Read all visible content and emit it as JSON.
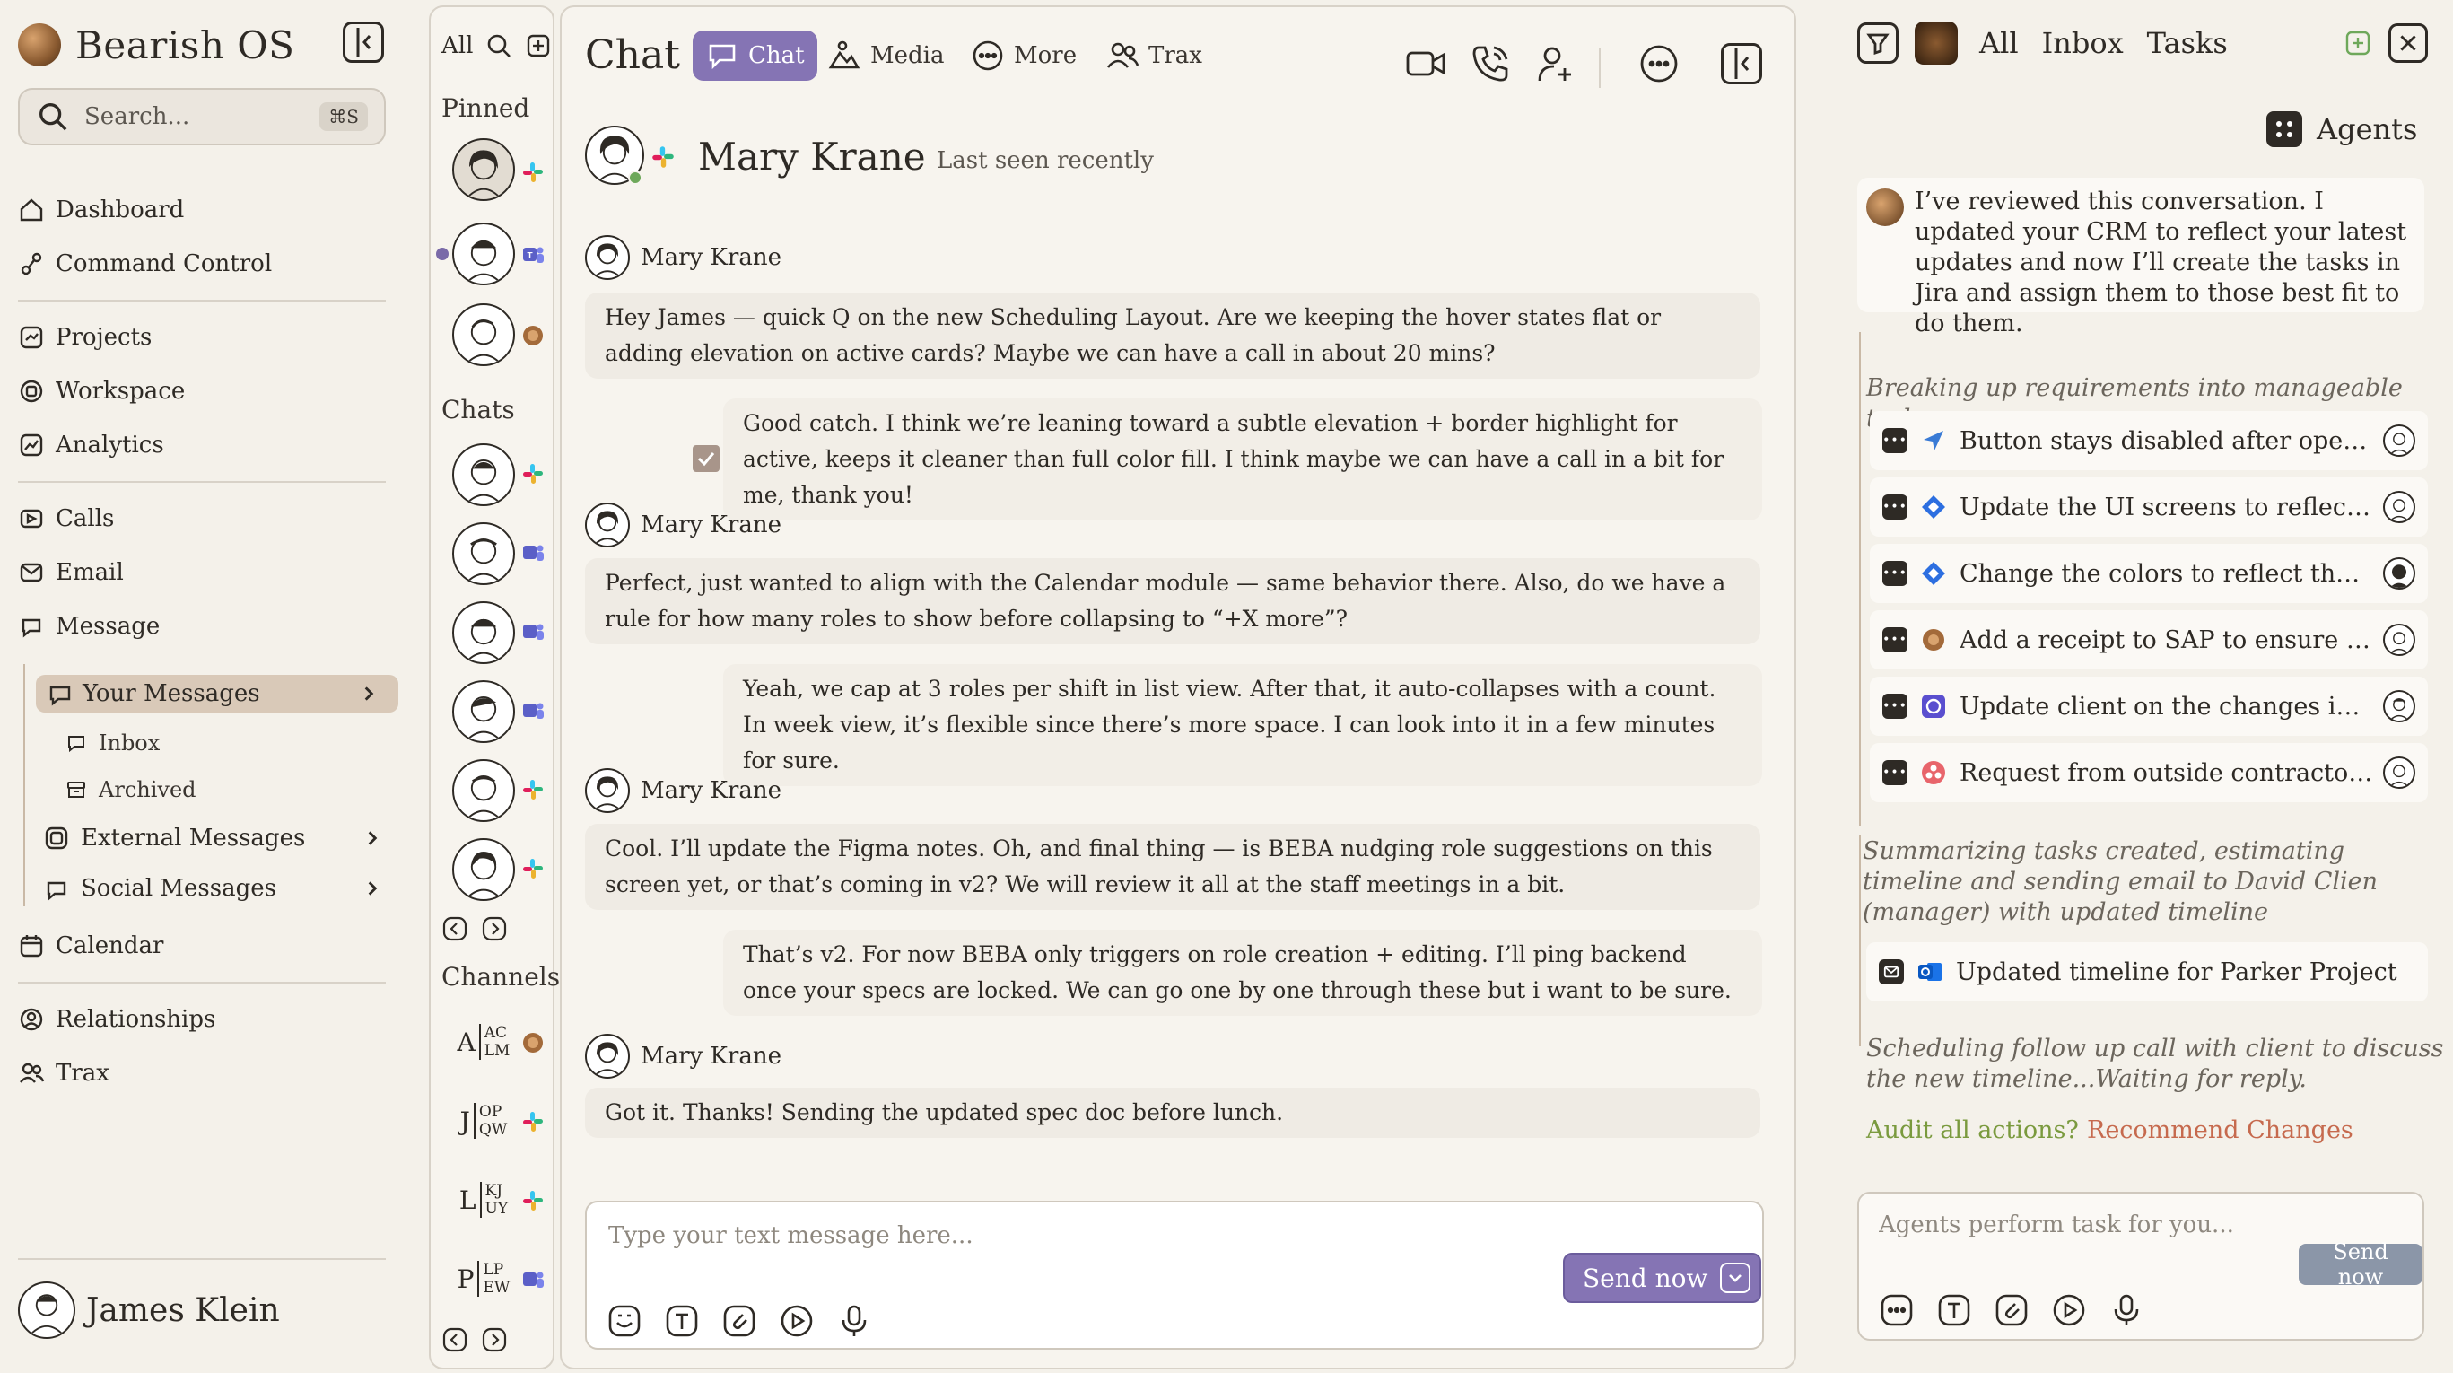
{
  "brand": {
    "name": "Bearish OS"
  },
  "search": {
    "placeholder": "Search...",
    "shortcut": "⌘S"
  },
  "nav": {
    "dashboard": "Dashboard",
    "command_control": "Command Control",
    "projects": "Projects",
    "workspace": "Workspace",
    "analytics": "Analytics",
    "calls": "Calls",
    "email": "Email",
    "message": "Message",
    "your_messages": "Your Messages",
    "inbox": "Inbox",
    "archived": "Archived",
    "external_messages": "External Messages",
    "social_messages": "Social Messages",
    "calendar": "Calendar",
    "relationships": "Relationships",
    "trax": "Trax"
  },
  "user": {
    "name": "James Klein"
  },
  "chatlist": {
    "all_label": "All",
    "pinned_label": "Pinned",
    "chats_label": "Chats",
    "channels_label": "Channels",
    "channels": [
      {
        "initial": "A",
        "mini": [
          "AC",
          "LM"
        ]
      },
      {
        "initial": "J",
        "mini": [
          "OP",
          "QW"
        ]
      },
      {
        "initial": "L",
        "mini": [
          "KJ",
          "UY"
        ]
      },
      {
        "initial": "P",
        "mini": [
          "LP",
          "EW"
        ]
      }
    ]
  },
  "chat": {
    "title": "Chat",
    "tabs": {
      "chat": "Chat",
      "media": "Media",
      "more": "More",
      "trax": "Trax"
    },
    "contact": {
      "name": "Mary Krane",
      "status": "Last seen recently"
    },
    "messages": [
      {
        "author": "Mary Krane",
        "text": "Hey James — quick Q on the new Scheduling Layout. Are we keeping the hover states flat or adding elevation on active cards? Maybe we can have a call in about 20 mins?"
      },
      {
        "author": "",
        "text": "Good catch. I think we’re leaning toward a subtle elevation + border highlight for active, keeps it cleaner than full color fill. I think maybe we can have a call in a bit for me, thank you!"
      },
      {
        "author": "Mary Krane",
        "text": "Perfect, just wanted to align with the Calendar module — same behavior there. Also, do we have a rule for how many roles to show before collapsing to “+X more”?"
      },
      {
        "author": "",
        "text": "Yeah, we cap at 3 roles per shift in list view. After that, it auto-collapses with a count. In week view, it’s flexible since there’s more space. I can look into it in a few minutes for sure."
      },
      {
        "author": "Mary Krane",
        "text": "Cool. I’ll update the Figma notes. Oh, and final thing — is BEBA nudging role suggestions on this screen yet, or that’s coming in v2? We will review it all at the staff meetings in a bit."
      },
      {
        "author": "",
        "text": "That’s v2. For now BEBA only triggers on role creation + editing. I’ll ping backend once your specs are locked. We can go one by one through these but i want to be sure."
      },
      {
        "author": "Mary Krane",
        "text": "Got it. Thanks! Sending the updated spec doc before lunch."
      }
    ],
    "composer": {
      "placeholder": "Type your text message here...",
      "send_label": "Send now"
    }
  },
  "agents": {
    "tabs": {
      "all": "All",
      "inbox": "Inbox",
      "tasks": "Tasks"
    },
    "label": "Agents",
    "summary": "I’ve reviewed this conversation. I updated your CRM to reflect your latest updates and now I’ll create the tasks in Jira and assign them to those best fit to do them.",
    "step1": "Breaking up requirements into manageable tasks",
    "tasks": [
      {
        "text": "Button stays disabled after opening...",
        "source": "arrow-icon",
        "color": "#3a7bd5"
      },
      {
        "text": "Update the UI screens to reflect the...",
        "source": "jira-icon",
        "color": "#2d6fe0"
      },
      {
        "text": "Change the colors to reflect the im...",
        "source": "jira-icon",
        "color": "#2d6fe0"
      },
      {
        "text": "Add a receipt to SAP to ensure compl...",
        "source": "bear-icon",
        "color": "#a36a3a"
      },
      {
        "text": "Update client on the changes in the...",
        "source": "linear-icon",
        "color": "#5a4fcf"
      },
      {
        "text": "Request from outside contractor to...",
        "source": "asana-icon",
        "color": "#e8656b"
      }
    ],
    "step2": "Summarizing tasks created, estimating timeline and sending email to David Clien (manager) with updated timeline",
    "email_task": "Updated timeline for Parker Project",
    "step3": "Scheduling follow up call with client to discuss the new timeline...Waiting for reply.",
    "audit": "Audit all actions?",
    "recommend": "Recommend Changes",
    "composer": {
      "placeholder": "Agents perform task for you...",
      "send_label": "Send now"
    }
  }
}
